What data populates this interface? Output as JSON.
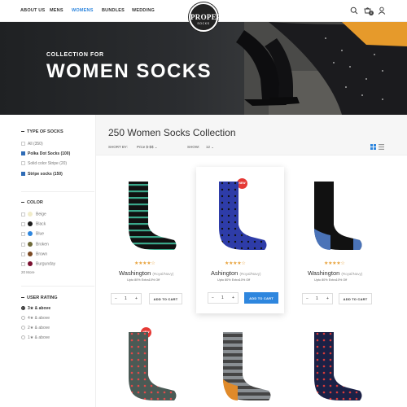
{
  "nav": {
    "links": [
      "ABOUT US",
      "MENS",
      "WOMENS",
      "BUNDLES",
      "WEDDING"
    ],
    "active_color": "#2e86de",
    "logo_line1": "PROPER",
    "logo_line2": "SOCKS",
    "cart_count": "0",
    "icons": [
      "search-icon",
      "cart-icon",
      "user-icon"
    ]
  },
  "hero": {
    "subtitle": "COLLECTION FOR",
    "title": "WOMEN SOCKS"
  },
  "sidebar": {
    "type_heading": "TYPE OF SOCKS",
    "types": [
      {
        "label": "All (350)",
        "checked": false
      },
      {
        "label": "Polka Dot Socks (100)",
        "checked": true
      },
      {
        "label": "Solid color Stripe (20)",
        "checked": false
      },
      {
        "label": "Stripe socks (150)",
        "checked": true
      }
    ],
    "color_heading": "COLOR",
    "colors": [
      {
        "label": "Beige",
        "color": "#f1ecc9"
      },
      {
        "label": "Black",
        "color": "#1a1a1a"
      },
      {
        "label": "Blue",
        "color": "#2e86de"
      },
      {
        "label": "Broken",
        "color": "#6f6a3a"
      },
      {
        "label": "Brown",
        "color": "#7b4a23"
      },
      {
        "label": "Burgunday",
        "color": "#7a1030"
      }
    ],
    "more_label": "20 More",
    "rating_heading": "USER RATING",
    "ratings": [
      "3★  & above",
      "4★  & above",
      "2★  & above",
      "1★  & above"
    ]
  },
  "collection": {
    "title": "250 Women Socks Collection",
    "sort_label": "SHORT BY:",
    "sort_value": "Price $-$$",
    "show_label": "SHOW:",
    "show_value": "12"
  },
  "products": [
    {
      "name": "Washington",
      "variant": "(Royal/Navy)",
      "desc": "Upto 80% Extra10% Off",
      "qty": "1",
      "button": "ADD TO CART",
      "badge": "",
      "rating": "★★★★☆"
    },
    {
      "name": "Ashington",
      "variant": "(Royal/Navy)",
      "desc": "Upto 80% Extra10% Off",
      "qty": "1",
      "button": "ADD TO CART",
      "badge": "NEW",
      "rating": "★★★★☆"
    },
    {
      "name": "Washington",
      "variant": "(Royal/Navy)",
      "desc": "Upto 80% Extra10% Off",
      "qty": "1",
      "button": "ADD TO CART",
      "badge": "",
      "rating": "★★★★☆"
    },
    {
      "name": "",
      "variant": "",
      "desc": "",
      "qty": "",
      "button": "",
      "badge": "NEW",
      "rating": ""
    },
    {
      "name": "",
      "variant": "",
      "desc": "",
      "qty": "",
      "button": "",
      "badge": "",
      "rating": ""
    },
    {
      "name": "",
      "variant": "",
      "desc": "",
      "qty": "",
      "button": "",
      "badge": "",
      "rating": ""
    }
  ]
}
